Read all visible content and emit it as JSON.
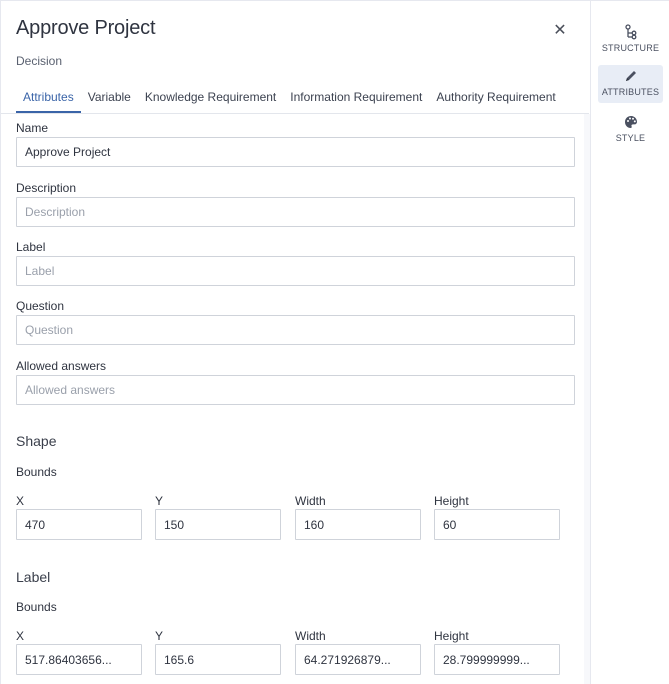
{
  "header": {
    "title": "Approve Project",
    "subtitle": "Decision",
    "close_icon": "close-icon"
  },
  "tabs": [
    {
      "label": "Attributes",
      "active": true
    },
    {
      "label": "Variable",
      "active": false
    },
    {
      "label": "Knowledge Requirement",
      "active": false
    },
    {
      "label": "Information Requirement",
      "active": false
    },
    {
      "label": "Authority Requirement",
      "active": false
    }
  ],
  "fields": {
    "name": {
      "label": "Name",
      "value": "Approve Project",
      "placeholder": ""
    },
    "description": {
      "label": "Description",
      "value": "",
      "placeholder": "Description"
    },
    "label": {
      "label": "Label",
      "value": "",
      "placeholder": "Label"
    },
    "question": {
      "label": "Question",
      "value": "",
      "placeholder": "Question"
    },
    "allowed_answers": {
      "label": "Allowed answers",
      "value": "",
      "placeholder": "Allowed answers"
    }
  },
  "shape": {
    "title": "Shape",
    "bounds_title": "Bounds",
    "x": {
      "label": "X",
      "value": "470"
    },
    "y": {
      "label": "Y",
      "value": "150"
    },
    "width": {
      "label": "Width",
      "value": "160"
    },
    "height": {
      "label": "Height",
      "value": "60"
    }
  },
  "label_section": {
    "title": "Label",
    "bounds_title": "Bounds",
    "x": {
      "label": "X",
      "value": "517.86403656..."
    },
    "y": {
      "label": "Y",
      "value": "165.6"
    },
    "width": {
      "label": "Width",
      "value": "64.271926879..."
    },
    "height": {
      "label": "Height",
      "value": "28.799999999..."
    }
  },
  "sidebar": {
    "items": [
      {
        "label": "STRUCTURE",
        "icon": "structure-icon",
        "active": false
      },
      {
        "label": "ATTRIBUTES",
        "icon": "pencil-icon",
        "active": true
      },
      {
        "label": "STYLE",
        "icon": "palette-icon",
        "active": false
      }
    ]
  },
  "colors": {
    "accent": "#3a64a8",
    "active_sidebar_bg": "#e8edf6",
    "border": "#cfd3da"
  }
}
